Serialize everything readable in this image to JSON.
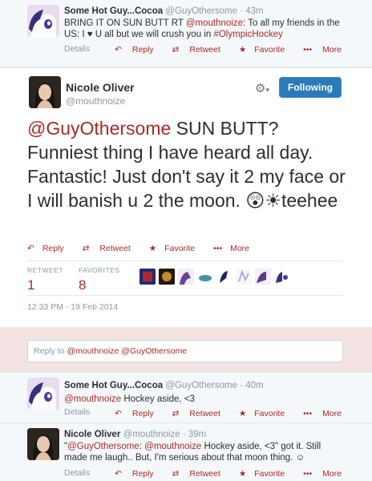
{
  "tweet1": {
    "name": "Some Hot Guy...Cocoa",
    "handle": "@GuyOthersome",
    "time": "· 43m",
    "text_pre": "BRING IT ON SUN BUTT RT ",
    "mention": "@mouthnoize",
    "text_mid": ": To all my friends in the US: I ",
    "heart": "♥",
    "text_mid2": " U all but we will crush you in ",
    "hashtag": "#OlympicHockey",
    "details": "Details"
  },
  "actions": {
    "reply": "Reply",
    "retweet": "Retweet",
    "favorite": "Favorite",
    "more": "More"
  },
  "main": {
    "name": "Nicole Oliver",
    "handle": "@mouthnoize",
    "follow_label": "Following",
    "mention": "@GuyOthersome",
    "text": " SUN BUTT? Funniest thing I have heard all day. Fantastic! Just don't say it 2 my face or I will banish u 2 the moon.",
    "emoji": "😲☀",
    "text_end": "teehee",
    "retweet_label": "RETWEET",
    "retweet_count": "1",
    "favorites_label": "FAVORITES",
    "favorites_count": "8",
    "timestamp": "12:33 PM - 19 Feb 2014"
  },
  "reply_box": {
    "prefix": "Reply to ",
    "mentions": "@mouthnoize @GuyOthersome"
  },
  "tweet2": {
    "name": "Some Hot Guy...Cocoa",
    "handle": "@GuyOthersome",
    "time": "· 40m",
    "mention": "@mouthnoize",
    "text": " Hockey aside, <3",
    "details": "Details"
  },
  "tweet3": {
    "name": "Nicole Oliver",
    "handle": "@mouthnoize",
    "time": "· 39m",
    "quote_open": "\"",
    "mention1": "@GuyOthersome",
    "colon": ": ",
    "mention2": "@mouthnoize",
    "text": " Hockey aside, <3\" got it. Still made me laugh.. But, I'm serious about that moon thing. ☺",
    "details": "Details"
  },
  "colors": {
    "link": "#a72a2a",
    "follow_button": "#2b7bb9",
    "reply_bg": "#f4e3e3"
  }
}
